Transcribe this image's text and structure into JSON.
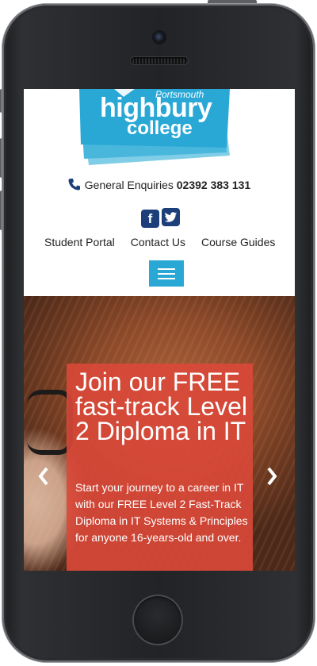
{
  "logo": {
    "location": "Portsmouth",
    "name_line1": "highbury",
    "name_line2": "college",
    "color": "#29a8d6"
  },
  "header": {
    "enquiries_label": "General Enquiries",
    "enquiries_number": "02392 383 131",
    "phone_icon": "phone-icon",
    "social": [
      {
        "icon": "facebook-icon",
        "glyph": "f"
      },
      {
        "icon": "twitter-icon",
        "glyph": "t"
      }
    ]
  },
  "nav": {
    "items": [
      "Student Portal",
      "Contact Us",
      "Course Guides"
    ],
    "menu_icon": "hamburger-menu-icon"
  },
  "hero": {
    "title": "Join our FREE fast-track Level 2 Diploma in IT",
    "body": "Start your journey to a career in IT with our FREE Level 2 Fast-Track Diploma in IT Systems & Principles for anyone 16-years-old and over.",
    "prev_arrow": "‹",
    "next_arrow": "›",
    "card_color": "#da4838"
  },
  "colors": {
    "accent": "#29a8d6",
    "social": "#1c3f7a"
  }
}
